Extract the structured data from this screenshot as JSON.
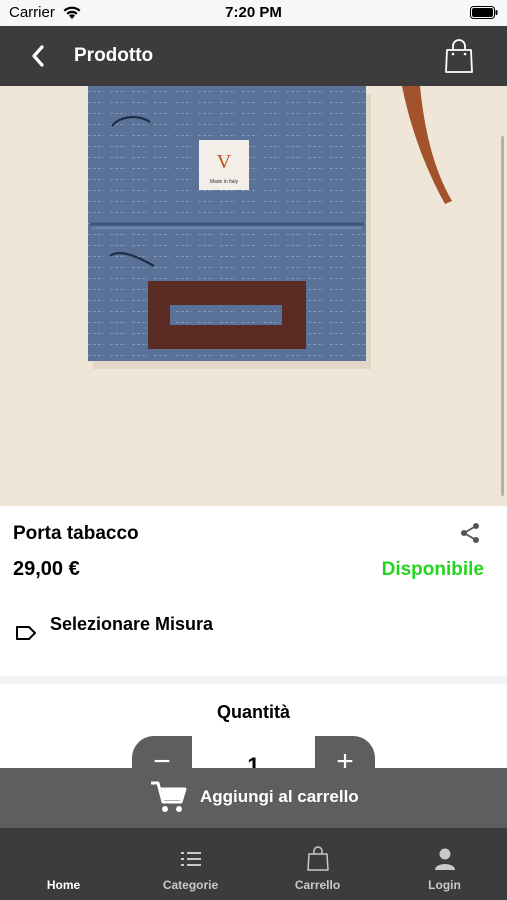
{
  "status_bar": {
    "carrier": "Carrier",
    "time": "7:20 PM",
    "icons": [
      "wifi-icon",
      "battery-icon"
    ]
  },
  "nav": {
    "title": "Prodotto",
    "back_icon": "chevron-left-icon",
    "cart_icon": "shopping-bag-icon"
  },
  "product": {
    "image_label": "V",
    "image_sublabel": "Made in Italy",
    "name": "Porta tabacco",
    "price": "29,00 €",
    "availability": "Disponibile",
    "size_label": "Selezionare Misura",
    "share_icon": "share-icon",
    "tag_icon": "tag-icon"
  },
  "quantity": {
    "label": "Quantità",
    "minus": "−",
    "value": "1",
    "plus": "+"
  },
  "cart_button": {
    "label": "Aggiungi al carrello",
    "icon": "cart-icon"
  },
  "tabs": [
    {
      "label": "Home",
      "icon": "home-icon"
    },
    {
      "label": "Categorie",
      "icon": "list-icon"
    },
    {
      "label": "Carrello",
      "icon": "bag-icon"
    },
    {
      "label": "Login",
      "icon": "user-icon"
    }
  ],
  "colors": {
    "nav_background": "#3c3c3c",
    "button_background": "#5e5e5e",
    "availability_green": "#22d61f",
    "hero_background": "#efe6d8",
    "pouch_denim": "#5a7297",
    "leather_brown": "#5a2b22"
  }
}
